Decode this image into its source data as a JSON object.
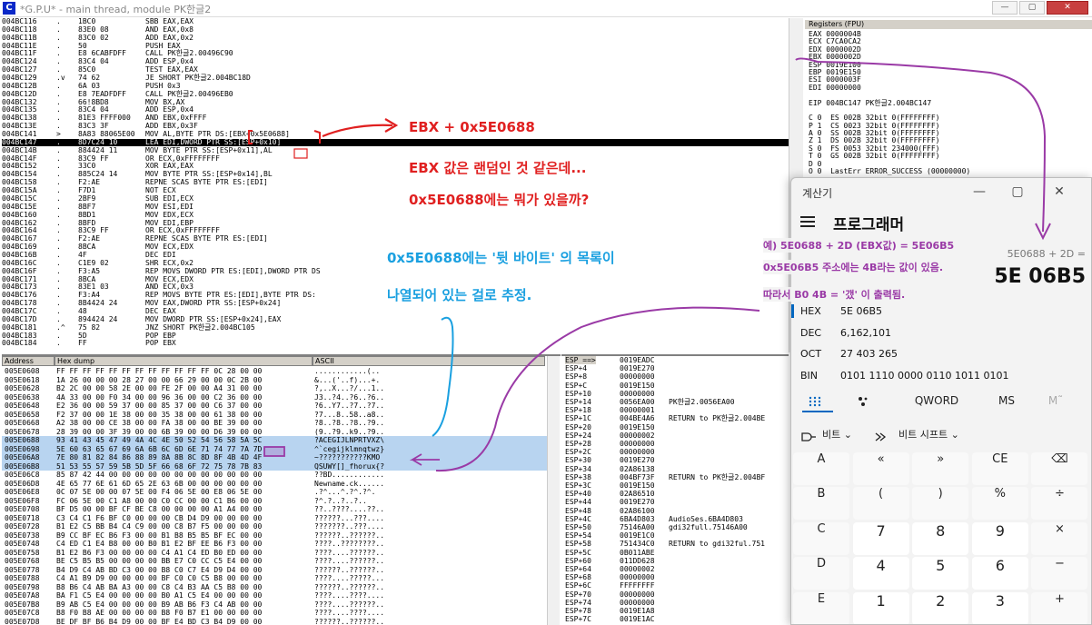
{
  "window": {
    "title": "*G.P.U* - main thread, module PK한글2",
    "app_icon_letter": "C",
    "buttons": [
      "—",
      "▢",
      "✕"
    ]
  },
  "cpu": [
    {
      "addr": "004BC116",
      "m": ".",
      "hex": "1BC0",
      "asm": "SBB EAX,EAX"
    },
    {
      "addr": "004BC118",
      "m": ".",
      "hex": "83E0 08",
      "asm": "AND EAX,0x8"
    },
    {
      "addr": "004BC11B",
      "m": ".",
      "hex": "83C0 02",
      "asm": "ADD EAX,0x2"
    },
    {
      "addr": "004BC11E",
      "m": ".",
      "hex": "50",
      "asm": "PUSH EAX"
    },
    {
      "addr": "004BC11F",
      "m": ".",
      "hex": "E8 6CABFDFF",
      "asm": "CALL PK한글2.00496C90"
    },
    {
      "addr": "004BC124",
      "m": ".",
      "hex": "83C4 04",
      "asm": "ADD ESP,0x4"
    },
    {
      "addr": "004BC127",
      "m": ".",
      "hex": "85C0",
      "asm": "TEST EAX,EAX"
    },
    {
      "addr": "004BC129",
      "m": ".v",
      "hex": "74 62",
      "asm": "JE SHORT PK한글2.004BC18D"
    },
    {
      "addr": "004BC12B",
      "m": ".",
      "hex": "6A 03",
      "asm": "PUSH 0x3"
    },
    {
      "addr": "004BC12D",
      "m": ".",
      "hex": "E8 7EADFDFF",
      "asm": "CALL PK한글2.00496EB0"
    },
    {
      "addr": "004BC132",
      "m": ".",
      "hex": "66!8BD8",
      "asm": "MOV BX,AX"
    },
    {
      "addr": "004BC135",
      "m": ".",
      "hex": "83C4 04",
      "asm": "ADD ESP,0x4"
    },
    {
      "addr": "004BC138",
      "m": ".",
      "hex": "81E3 FFFF000",
      "asm": "AND EBX,0xFFFF"
    },
    {
      "addr": "004BC13E",
      "m": ".",
      "hex": "83C3 3F",
      "asm": "ADD EBX,0x3F"
    },
    {
      "addr": "004BC141",
      "m": ">",
      "hex": "8A83 88065E00",
      "asm": "MOV AL,BYTE PTR DS:[EBX+0x5E0688]"
    },
    {
      "addr": "004BC147",
      "m": ".",
      "hex": "8D7C24 10",
      "asm": "LEA EDI,DWORD PTR SS:[ESP+0x10]"
    },
    {
      "addr": "004BC14B",
      "m": ".",
      "hex": "884424 11",
      "asm": "MOV BYTE PTR SS:[ESP+0x11],AL"
    },
    {
      "addr": "004BC14F",
      "m": ".",
      "hex": "83C9 FF",
      "asm": "OR ECX,0xFFFFFFFF"
    },
    {
      "addr": "004BC152",
      "m": ".",
      "hex": "33C0",
      "asm": "XOR EAX,EAX"
    },
    {
      "addr": "004BC154",
      "m": ".",
      "hex": "885C24 14",
      "asm": "MOV BYTE PTR SS:[ESP+0x14],BL"
    },
    {
      "addr": "004BC158",
      "m": ".",
      "hex": "F2:AE",
      "asm": "REPNE SCAS BYTE PTR ES:[EDI]"
    },
    {
      "addr": "004BC15A",
      "m": ".",
      "hex": "F7D1",
      "asm": "NOT ECX"
    },
    {
      "addr": "004BC15C",
      "m": ".",
      "hex": "2BF9",
      "asm": "SUB EDI,ECX"
    },
    {
      "addr": "004BC15E",
      "m": ".",
      "hex": "8BF7",
      "asm": "MOV ESI,EDI"
    },
    {
      "addr": "004BC160",
      "m": ".",
      "hex": "8BD1",
      "asm": "MOV EDX,ECX"
    },
    {
      "addr": "004BC162",
      "m": ".",
      "hex": "8BFD",
      "asm": "MOV EDI,EBP"
    },
    {
      "addr": "004BC164",
      "m": ".",
      "hex": "83C9 FF",
      "asm": "OR ECX,0xFFFFFFFF"
    },
    {
      "addr": "004BC167",
      "m": ".",
      "hex": "F2:AE",
      "asm": "REPNE SCAS BYTE PTR ES:[EDI]"
    },
    {
      "addr": "004BC169",
      "m": ".",
      "hex": "8BCA",
      "asm": "MOV ECX,EDX"
    },
    {
      "addr": "004BC16B",
      "m": ".",
      "hex": "4F",
      "asm": "DEC EDI"
    },
    {
      "addr": "004BC16C",
      "m": ".",
      "hex": "C1E9 02",
      "asm": "SHR ECX,0x2"
    },
    {
      "addr": "004BC16F",
      "m": ".",
      "hex": "F3:A5",
      "asm": "REP MOVS DWORD PTR ES:[EDI],DWORD PTR DS"
    },
    {
      "addr": "004BC171",
      "m": ".",
      "hex": "8BCA",
      "asm": "MOV ECX,EDX"
    },
    {
      "addr": "004BC173",
      "m": ".",
      "hex": "83E1 03",
      "asm": "AND ECX,0x3"
    },
    {
      "addr": "004BC176",
      "m": ".",
      "hex": "F3:A4",
      "asm": "REP MOVS BYTE PTR ES:[EDI],BYTE PTR DS:"
    },
    {
      "addr": "004BC178",
      "m": ".",
      "hex": "8B4424 24",
      "asm": "MOV EAX,DWORD PTR SS:[ESP+0x24]"
    },
    {
      "addr": "004BC17C",
      "m": ".",
      "hex": "48",
      "asm": "DEC EAX"
    },
    {
      "addr": "004BC17D",
      "m": ".",
      "hex": "894424 24",
      "asm": "MOV DWORD PTR SS:[ESP+0x24],EAX"
    },
    {
      "addr": "004BC181",
      "m": ".^",
      "hex": "75 82",
      "asm": "JNZ SHORT PK한글2.004BC105"
    },
    {
      "addr": "004BC183",
      "m": ".",
      "hex": "5D",
      "asm": "POP EBP"
    },
    {
      "addr": "004BC184",
      "m": ".",
      "hex": "FF",
      "asm": "POP EBX"
    }
  ],
  "registers": {
    "header": "Registers (FPU)",
    "lines": [
      "EAX 0000004B",
      "ECX C7CA0CA2",
      "EDX 0000002D",
      "EBX 0000002D",
      "ESP 0019E100",
      "EBP 0019E150",
      "ESI 0000003F",
      "EDI 00000000",
      "",
      "EIP 004BC147 PK한글2.004BC147",
      "",
      "C 0  ES 002B 32bit 0(FFFFFFFF)",
      "P 1  CS 0023 32bit 0(FFFFFFFF)",
      "A 0  SS 002B 32bit 0(FFFFFFFF)",
      "Z 1  DS 002B 32bit 0(FFFFFFFF)",
      "S 0  FS 0053 32bit 234000(FFF)",
      "T 0  GS 002B 32bit 0(FFFFFFFF)",
      "D 0",
      "O 0  LastErr ERROR_SUCCESS (00000000)"
    ]
  },
  "dump": {
    "headers": [
      "Address",
      "Hex dump",
      "ASCII"
    ],
    "rows": [
      [
        "005E0608",
        "FF FF FF FF FF FF FF FF FF FF FF FF 0C 28 00 00",
        "............(.."
      ],
      [
        "005E0618",
        "1A 26 00 00 00 28 27 00 00 66 29 00 00 0C 2B 00",
        "&...('..f)...+."
      ],
      [
        "005E0628",
        "B2 2C 00 00 58 2E 00 00 FE 2F 00 00 A4 31 00 00",
        "?,..X...?/...1.."
      ],
      [
        "005E0638",
        "4A 33 00 00 F0 34 00 00 96 36 00 00 C2 36 00 00",
        "J3..?4..?6..?6.."
      ],
      [
        "005E0648",
        "E2 36 00 00 59 37 00 00 85 37 00 00 C6 37 00 00",
        "?6..Y7..?7..?7.."
      ],
      [
        "005E0658",
        "F2 37 00 00 1E 38 00 00 35 38 00 00 61 38 00 00",
        "?7...8..58..a8.."
      ],
      [
        "005E0668",
        "A2 38 00 00 CE 38 00 00 FA 38 00 00 BE 39 00 00",
        "?8..?8..?8..?9.."
      ],
      [
        "005E0678",
        "28 39 00 00 3F 39 00 00 6B 39 00 00 D6 39 00 00",
        "(9..?9..k9..?9.."
      ],
      [
        "005E0688",
        "93 41 43 45 47 49 4A 4C 4E 50 52 54 56 58 5A 5C",
        "?ACEGIJLNPRTVXZ\\"
      ],
      [
        "005E0698",
        "5E 60 63 65 67 69 6A 6B 6C 6D 6E 71 74 77 7A 7D",
        "^`cegijklmnqtwz}"
      ],
      [
        "005E06A8",
        "7E 80 81 82 84 86 88 89 8A 8B 8C 8D 8F 4B 4D 4F",
        "~???????????KMO"
      ],
      [
        "005E06B8",
        "51 53 55 57 59 5B 5D 5F 66 68 6F 72 75 78 7B 83",
        "QSUWY[]_fhorux{?"
      ],
      [
        "005E06C8",
        "85 87 42 44 00 00 00 00 00 00 00 00 00 00 00 00",
        "??BD............"
      ],
      [
        "005E06D8",
        "4E 65 77 6E 61 6D 65 2E 63 6B 00 00 00 00 00 00",
        "Newname.ck......"
      ],
      [
        "005E06E8",
        "0C 07 5E 00 00 07 5E 00 F4 06 5E 00 E8 06 5E 00",
        ".?^...^.?^.?^."
      ],
      [
        "005E06F8",
        "FC 06 5E 00 C1 A8 00 00 C0 CC 00 00 C1 B6 00 00",
        "?^.?..?..?.."
      ],
      [
        "005E0708",
        "BF D5 00 00 BF CF BE C8 00 00 00 00 A1 A4 00 00",
        "??..????....??.."
      ],
      [
        "005E0718",
        "C3 C4 C1 F6 BF C0 00 00 00 CB D4 D9 00 00 00 00",
        "??????...???...."
      ],
      [
        "005E0728",
        "B1 E2 C5 BB B4 C4 C9 00 00 C8 B7 F5 00 00 00 00",
        "???????..???...."
      ],
      [
        "005E0738",
        "B9 CC BF EC B6 F3 00 00 B1 B8 B5 B5 BF EC 00 00",
        "??????..??????.."
      ],
      [
        "005E0748",
        "C4 ED C1 E4 B8 00 00 B0 B1 E2 BF EE B6 F3 00 00",
        "????..????????.."
      ],
      [
        "005E0758",
        "B1 E2 B6 F3 00 00 00 00 C4 A1 C4 ED B0 ED 00 00",
        "????....??????.."
      ],
      [
        "005E0768",
        "BE C5 B5 B5 00 00 00 00 BB E7 C0 CC C5 E4 00 00",
        "????....??????.."
      ],
      [
        "005E0778",
        "B4 D9 C4 AB BD C3 00 00 B8 C0 C7 E4 D9 D4 00 00",
        "??????..??????.."
      ],
      [
        "005E0788",
        "C4 A1 B9 D9 00 00 00 00 BF C0 C0 C5 B8 00 00 00",
        "????....?????..."
      ],
      [
        "005E0798",
        "B8 B6 C4 AB BA A3 00 00 C8 C4 B3 AA C5 B8 00 00",
        "??????..??????.."
      ],
      [
        "005E07A8",
        "BA F1 C5 E4 00 00 00 00 B0 A1 C5 E4 00 00 00 00",
        "????....????...."
      ],
      [
        "005E07B8",
        "B9 AB C5 E4 00 00 00 00 B9 AB B6 F3 C4 AB 00 00",
        "????....??????.."
      ],
      [
        "005E07C8",
        "B8 F0 B8 AE 00 00 00 00 B8 F0 B7 E1 00 00 00 00",
        "????....????...."
      ],
      [
        "005E07D8",
        "BE DF BF B6 B4 D9 00 00 BF E4 BD C3 B4 D9 00 00",
        "??????..??????.."
      ]
    ]
  },
  "stack": {
    "header": "ESP ==>",
    "rows": [
      [
        "ESP",
        "0019EADC",
        ""
      ],
      [
        "ESP+4",
        "0019E270",
        ""
      ],
      [
        "ESP+8",
        "00000000",
        ""
      ],
      [
        "ESP+C",
        "0019E150",
        ""
      ],
      [
        "ESP+10",
        "00000000",
        ""
      ],
      [
        "ESP+14",
        "0056EA00",
        "PK한글2.0056EA00"
      ],
      [
        "ESP+18",
        "00000001",
        ""
      ],
      [
        "ESP+1C",
        "004BE4A6",
        "RETURN to PK한글2.004BE"
      ],
      [
        "ESP+20",
        "0019E150",
        ""
      ],
      [
        "ESP+24",
        "00000002",
        ""
      ],
      [
        "ESP+28",
        "00000000",
        ""
      ],
      [
        "ESP+2C",
        "00000000",
        ""
      ],
      [
        "ESP+30",
        "0019E270",
        ""
      ],
      [
        "ESP+34",
        "02A86138",
        ""
      ],
      [
        "ESP+38",
        "004BF73F",
        "RETURN to PK한글2.004BF"
      ],
      [
        "ESP+3C",
        "0019E150",
        ""
      ],
      [
        "ESP+40",
        "02A86510",
        ""
      ],
      [
        "ESP+44",
        "0019E270",
        ""
      ],
      [
        "ESP+48",
        "02A86100",
        ""
      ],
      [
        "ESP+4C",
        "6BA4D803",
        "AudioSes.6BA4D803"
      ],
      [
        "ESP+50",
        "75146A00",
        "gdi32full.75146A00"
      ],
      [
        "ESP+54",
        "0019E1C0",
        ""
      ],
      [
        "ESP+58",
        "751434C0",
        "RETURN to gdi32ful.751"
      ],
      [
        "ESP+5C",
        "0B011ABE",
        ""
      ],
      [
        "ESP+60",
        "011DD628",
        ""
      ],
      [
        "ESP+64",
        "00000002",
        ""
      ],
      [
        "ESP+68",
        "00000000",
        ""
      ],
      [
        "ESP+6C",
        "FFFFFFFF",
        ""
      ],
      [
        "ESP+70",
        "00000000",
        ""
      ],
      [
        "ESP+74",
        "00000000",
        ""
      ],
      [
        "ESP+78",
        "0019E1A8",
        ""
      ],
      [
        "ESP+7C",
        "0019E1AC",
        ""
      ]
    ]
  },
  "calculator": {
    "title": "계산기",
    "mode": "프로그래머",
    "expression": "5E0688 + 2D =",
    "result": "5E 06B5",
    "radix": [
      {
        "label": "HEX",
        "value": "5E 06B5"
      },
      {
        "label": "DEC",
        "value": "6,162,101"
      },
      {
        "label": "OCT",
        "value": "27 403 265"
      },
      {
        "label": "BIN",
        "value": "0101 1110 0000 0110 1011 0101"
      }
    ],
    "tabs": [
      "QWORD",
      "MS",
      "M˜"
    ],
    "bitwise": [
      "비트",
      "비트 시프트"
    ],
    "keys": [
      [
        "A",
        "«",
        "»",
        "CE",
        "⌫"
      ],
      [
        "B",
        "(",
        ")",
        "%",
        "÷"
      ],
      [
        "C",
        "7",
        "8",
        "9",
        "×"
      ],
      [
        "D",
        "4",
        "5",
        "6",
        "−"
      ],
      [
        "E",
        "1",
        "2",
        "3",
        "+"
      ]
    ],
    "window_buttons": [
      "—",
      "▢",
      "✕"
    ]
  },
  "annotations": {
    "red1": "EBX + 0x5E0688",
    "red2": "EBX 값은 랜덤인 것 같은데...",
    "red3": "0x5E0688에는 뭐가 있을까?",
    "blue1": "0x5E0688에는 '뒷 바이트' 의 목록이",
    "blue2": "나열되어 있는 걸로 추정.",
    "purple1": "예) 5E0688 + 2D (EBX값) = 5E06B5",
    "purple2": "0x5E06B5 주소에는 4B라는 값이 있음.",
    "purple3": "따라서 B0 4B = '갰' 이 출력됨.",
    "colors": {
      "red": "#e02020",
      "blue": "#1aa0e0",
      "purple": "#9a3aa6"
    }
  }
}
